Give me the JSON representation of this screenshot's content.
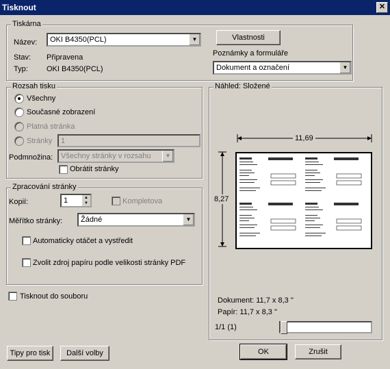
{
  "window": {
    "title": "Tisknout",
    "close_glyph": "✕"
  },
  "printer": {
    "legend": "Tiskárna",
    "name_label": "Název:",
    "name_value": "OKI B4350(PCL)",
    "status_label": "Stav:",
    "status_value": "Připravena",
    "type_label": "Typ:",
    "type_value": "OKI B4350(PCL)",
    "properties_button": "Vlastnosti",
    "notes_label": "Poznámky a formuláře",
    "notes_value": "Dokument a označení"
  },
  "range": {
    "legend": "Rozsah tisku",
    "all": "Všechny",
    "current_view": "Současné zobrazení",
    "current_page": "Platná stránka",
    "pages": "Stránky",
    "pages_value": "1",
    "subset_label": "Podmnožina:",
    "subset_value": "Všechny stránky v rozsahu",
    "reverse": "Obrátit stránky"
  },
  "handling": {
    "legend": "Zpracování stránky",
    "copies_label": "Kopií:",
    "copies_value": "1",
    "collate": "Kompletova",
    "scaling_label": "Měřítko stránky:",
    "scaling_value": "Žádné",
    "auto_rotate": "Automaticky otáčet a vystředit",
    "pdf_source": "Zvolit zdroj papíru podle velikosti stránky PDF"
  },
  "print_to_file": "Tisknout do souboru",
  "preview": {
    "legend": "Náhled: Složené",
    "width_label": "11,69",
    "height_label": "8,27",
    "document_size": "Dokument: 11,7 x 8,3 ''",
    "paper_size": "Papír: 11,7 x 8,3 ''",
    "page_counter": "1/1 (1)",
    "slider_fraction": 0
  },
  "buttons": {
    "tips": "Tipy pro tisk",
    "more": "Další volby",
    "ok": "OK",
    "cancel": "Zrušit"
  }
}
